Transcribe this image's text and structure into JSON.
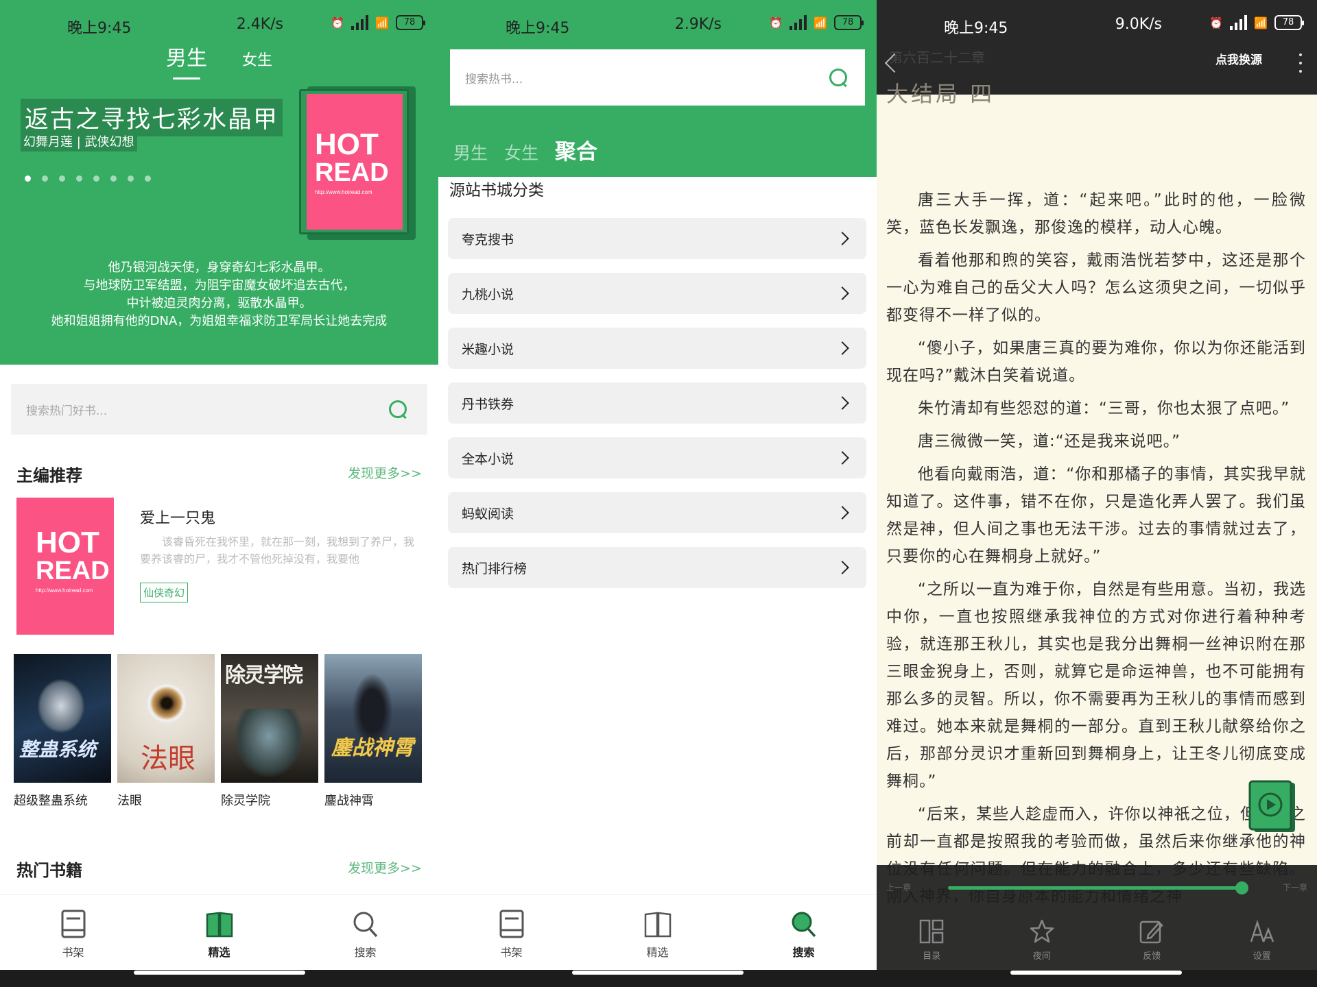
{
  "status": {
    "time": "晚上9:45",
    "speeds": [
      "2.4K/s",
      "2.9K/s",
      "9.0K/s"
    ],
    "battery": "78"
  },
  "panel1": {
    "tabs": [
      "男生",
      "女生"
    ],
    "hero": {
      "title": "返古之寻找七彩水晶甲",
      "subtitle": "幻舞月莲 | 武侠幻想",
      "cover_text": [
        "HOT",
        "READ",
        "http://www.hotread.com"
      ],
      "description": [
        "他乃银河战天使，身穿奇幻七彩水晶甲。",
        "与地球防卫军结盟，为阻宇宙魔女破坏追去古代，",
        "中计被迫灵肉分离，驱散水晶甲。",
        "她和姐姐拥有他的DNA，为姐姐幸福求防卫军局长让她去完成"
      ],
      "dot_count": 8,
      "active_dot": 0
    },
    "search_placeholder": "搜索热门好书...",
    "section_editor": {
      "title": "主编推荐",
      "more": "发现更多>>"
    },
    "featured": {
      "name": "爱上一只鬼",
      "desc": "该睿昏死在我怀里，就在那一刻，我想到了养尸，我要养该睿的尸，我才不管他死掉没有，我要他",
      "tag": "仙侠奇幻",
      "cover_text": [
        "HOT",
        "READ",
        "http://www.hotread.com"
      ]
    },
    "books": [
      {
        "title": "超级整蛊系统",
        "cover_text": "整蛊系统"
      },
      {
        "title": "法眼",
        "cover_text": "法眼"
      },
      {
        "title": "除灵学院",
        "cover_text": "除灵学院"
      },
      {
        "title": "鏖战神霄",
        "cover_text": "鏖战神霄"
      }
    ],
    "section_hot": {
      "title": "热门书籍",
      "more": "发现更多>>"
    }
  },
  "panel2": {
    "search_placeholder": "搜索热书...",
    "tabs": [
      "男生",
      "女生",
      "聚合"
    ],
    "section": "源站书城分类",
    "sources": [
      "夸克搜书",
      "九桃小说",
      "米趣小说",
      "丹书铁券",
      "全本小说",
      "蚂蚁阅读",
      "热门排行榜"
    ]
  },
  "nav": {
    "shelf": "书架",
    "featured": "精选",
    "search": "搜索"
  },
  "panel3": {
    "chapter_small": "第六百二十二章",
    "chapter_big": "大结局 四",
    "switch_source": "点我换源",
    "paragraphs": [
      "唐三大手一挥，道：“起来吧。”此时的他，一脸微笑，蓝色长发飘逸，那俊逸的模样，动人心魄。",
      "看着他那和煦的笑容，戴雨浩恍若梦中，这还是那个一心为难自己的岳父大人吗？怎么这须臾之间，一切似乎都变得不一样了似的。",
      "“傻小子，如果唐三真的要为难你，你以为你还能活到现在吗?”戴沐白笑着说道。",
      "朱竹清却有些怨怼的道：“三哥，你也太狠了点吧。”",
      "唐三微微一笑，道:“还是我来说吧。”",
      "他看向戴雨浩，道：“你和那橘子的事情，其实我早就知道了。这件事，错不在你，只是造化弄人罢了。我们虽然是神，但人间之事也无法干涉。过去的事情就过去了，只要你的心在舞桐身上就好。”",
      "“之所以一直为难于你，自然是有些用意。当初，我选中你，一直也按照继承我神位的方式对你进行着种种考验，就连那王秋儿，其实也是我分出舞桐一丝神识附在那三眼金猊身上，否则，就算它是命运神兽，也不可能拥有那么多的灵智。所以，你不需要再为王秋儿的事情而感到难过。她本来就是舞桐的一部分。直到王秋儿献祭给你之后，那部分灵识才重新回到舞桐身上，让王冬儿彻底变成舞桐。”",
      "“后来，某些人趁虚而入，许你以神祇之位，但你在之前却一直都是按照我的考验而做，虽然后来你继承他的神位没有任何问题。但在能力的融合上，多少还有些缺陷。刚入神界，你自身原本的能力和情绪之神"
    ],
    "prev": "上一章",
    "next": "下一章",
    "progress": 0.95,
    "menu": [
      "目录",
      "夜间",
      "反馈",
      "设置"
    ]
  },
  "colors": {
    "accent": "#36ad63",
    "hot_pink": "#fb5384",
    "paper": "#fcf8e8"
  }
}
